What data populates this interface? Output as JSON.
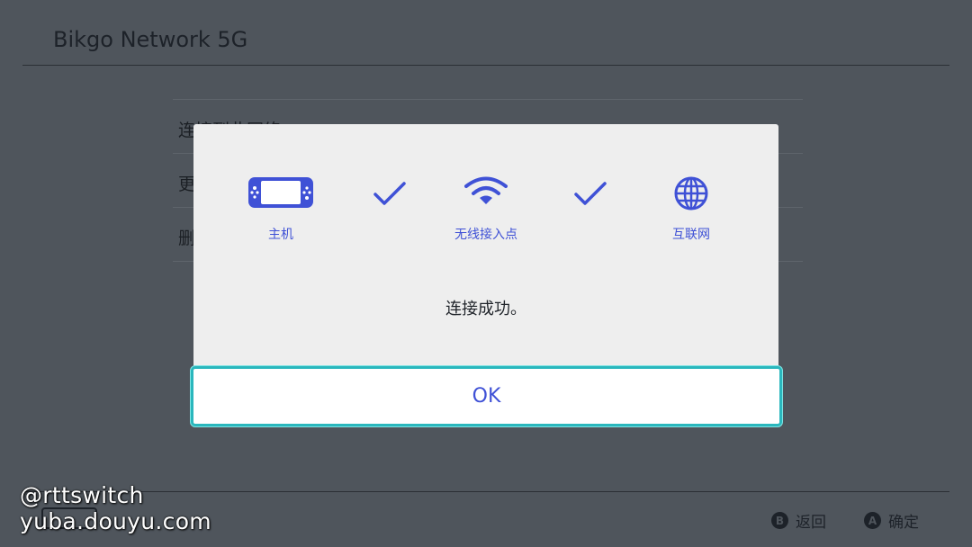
{
  "header": {
    "title": "Bikgo Network 5G"
  },
  "menu": {
    "items": [
      "连接到此网络",
      "更",
      "删"
    ]
  },
  "dialog": {
    "steps": [
      {
        "icon": "console-icon",
        "label": "主机"
      },
      {
        "icon": "wifi-icon",
        "label": "无线接入点"
      },
      {
        "icon": "globe-icon",
        "label": "互联网"
      }
    ],
    "message": "连接成功。",
    "ok_label": "OK"
  },
  "footer": {
    "back": {
      "key": "B",
      "label": "返回"
    },
    "confirm": {
      "key": "A",
      "label": "确定"
    }
  },
  "watermark": {
    "line1": "@rttswitch",
    "line2": "yuba.douyu.com"
  },
  "colors": {
    "accent": "#3f51d6",
    "focus_border": "#2ab7bd",
    "background": "#4f555c",
    "dialog_bg": "#eeeeee"
  }
}
